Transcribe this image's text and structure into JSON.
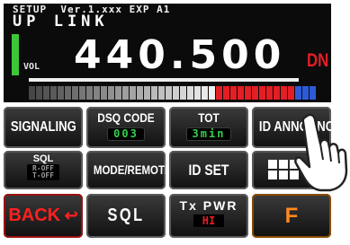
{
  "display": {
    "setup_line": "SETUP  Ver.1.xxx EXP A1",
    "mode": "UP LINK",
    "vol_label": "VOL",
    "frequency": "440.500",
    "shift": "DN",
    "colors": {
      "background": "#0b0b0b",
      "vol_bar": "#3ec63a",
      "shift": "#e31e24",
      "meter_tot": "#e31e24",
      "meter_end": "#2d5bd8"
    }
  },
  "buttons": {
    "row1": {
      "signaling": "SIGNALING",
      "dsq_code": "DSQ CODE",
      "dsq_code_value": "003",
      "tot": "TOT",
      "tot_value": "3min",
      "id_announce": "ID ANNOUNCE"
    },
    "row2": {
      "sql": "SQL",
      "sql_sub1": "R-OFF",
      "sql_sub2": "T-OFF",
      "mode_remote": "MODE/REMOTE",
      "id_set": "ID SET",
      "grid_icon": "grid-menu-icon"
    },
    "row3": {
      "back": "BACK",
      "back_icon": "return-arrow-icon",
      "sql": "SQL",
      "tx_pwr": "Tx PWR",
      "tx_pwr_value": "HI",
      "f": "F"
    }
  },
  "overlay": {
    "hand_icon": "pointing-hand-icon"
  }
}
